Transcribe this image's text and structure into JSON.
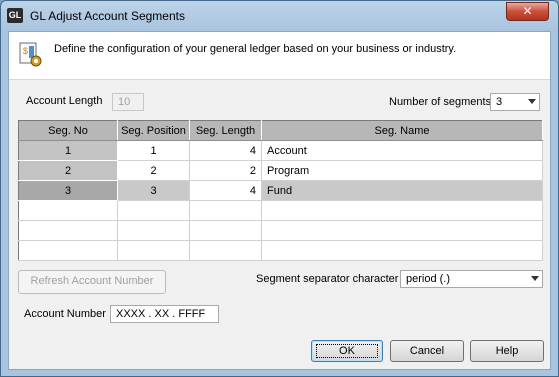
{
  "window": {
    "app_icon_text": "GL",
    "title": "GL Adjust Account Segments",
    "close_glyph": "✕"
  },
  "header": {
    "description": "Define the configuration of your general ledger based on your business or industry."
  },
  "account_length": {
    "label": "Account Length",
    "value": "10"
  },
  "num_segments": {
    "label": "Number of segments",
    "value": "3"
  },
  "grid": {
    "columns": [
      "Seg. No",
      "Seg. Position",
      "Seg. Length",
      "Seg. Name"
    ],
    "rows": [
      {
        "no": "1",
        "position": "1",
        "length": "4",
        "name": "Account"
      },
      {
        "no": "2",
        "position": "2",
        "length": "2",
        "name": "Program"
      },
      {
        "no": "3",
        "position": "3",
        "length": "4",
        "name": "Fund"
      }
    ],
    "selected_row": 3
  },
  "refresh_button": "Refresh Account Number",
  "separator": {
    "label": "Segment separator character",
    "value": "period (.)"
  },
  "account_number": {
    "label": "Account Number",
    "value": "XXXX . XX . FFFF"
  },
  "buttons": {
    "ok": "OK",
    "cancel": "Cancel",
    "help": "Help"
  },
  "icons": {
    "header": "document-gear-icon",
    "close": "close-icon"
  },
  "colors": {
    "grid_header": "#b7b7b7",
    "selected_row": "#c9c9c9",
    "close_button": "#c9503b"
  }
}
